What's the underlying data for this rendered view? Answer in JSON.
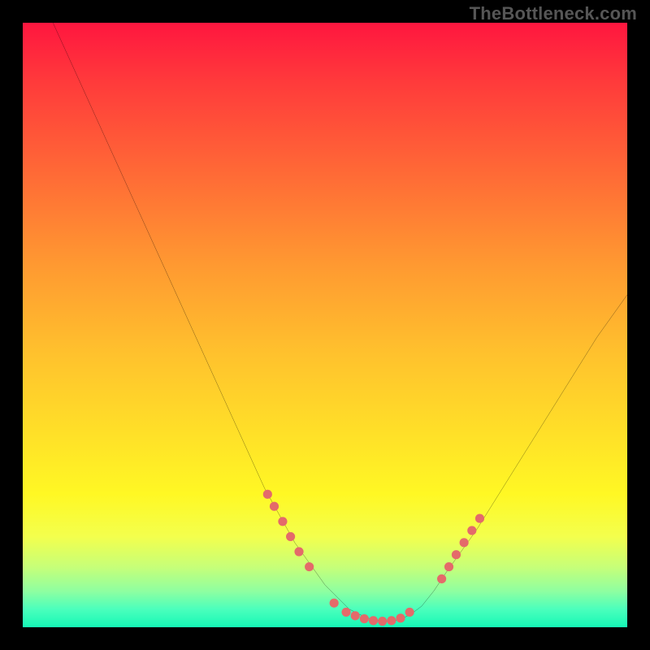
{
  "watermark": "TheBottleneck.com",
  "chart_data": {
    "type": "line",
    "title": "",
    "xlabel": "",
    "ylabel": "",
    "xlim": [
      0,
      100
    ],
    "ylim": [
      0,
      100
    ],
    "series": [
      {
        "name": "curve",
        "style": "line",
        "color": "#000000",
        "x": [
          5,
          10,
          15,
          20,
          25,
          30,
          35,
          40,
          45,
          50,
          52,
          54,
          56,
          58,
          60,
          62,
          64,
          66,
          68,
          70,
          75,
          80,
          85,
          90,
          95,
          100
        ],
        "y": [
          100,
          89,
          78,
          67,
          56,
          45,
          34,
          23,
          14,
          7,
          5,
          3,
          2,
          1.2,
          1,
          1.2,
          2,
          3.5,
          6,
          9,
          16,
          24,
          32,
          40,
          48,
          55
        ]
      },
      {
        "name": "optimal-markers-left",
        "style": "scatter",
        "color": "#e46a6a",
        "x": [
          40.5,
          41.6,
          43.0,
          44.3,
          45.7,
          47.4
        ],
        "y": [
          22,
          20,
          17.5,
          15,
          12.5,
          10
        ]
      },
      {
        "name": "optimal-markers-bottom",
        "style": "scatter",
        "color": "#e46a6a",
        "x": [
          51.5,
          53.5,
          55,
          56.5,
          58,
          59.5,
          61,
          62.5,
          64
        ],
        "y": [
          4.0,
          2.5,
          1.9,
          1.4,
          1.1,
          1.0,
          1.1,
          1.5,
          2.5
        ]
      },
      {
        "name": "optimal-markers-right",
        "style": "scatter",
        "color": "#e46a6a",
        "x": [
          69.3,
          70.5,
          71.7,
          73.0,
          74.3,
          75.6
        ],
        "y": [
          8,
          10,
          12,
          14,
          16,
          18
        ]
      }
    ]
  }
}
